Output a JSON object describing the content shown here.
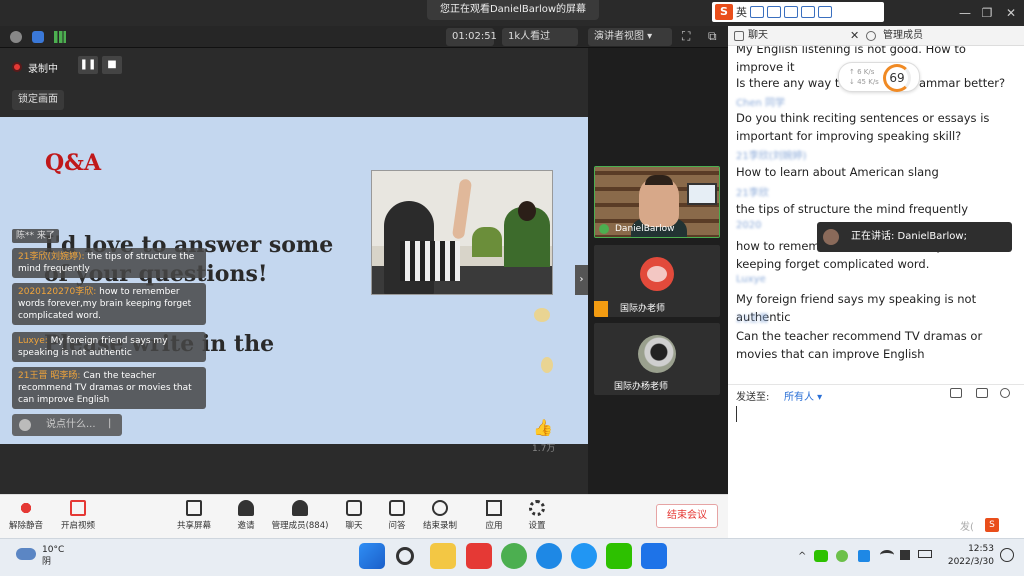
{
  "top": {
    "viewing_banner": "您正在观看DanielBarlow的屏幕",
    "ime_logo": "S",
    "ime_lang": "英",
    "win_min": "—",
    "win_max": "❐",
    "win_close": "✕"
  },
  "toolbar2": {
    "timer": "01:02:51",
    "viewers": "1k人看过",
    "view_mode": "演讲者视图 ▾",
    "fullscreen": "⛶",
    "popout": "⧉"
  },
  "recording": {
    "label": "录制中",
    "pause": "❚❚",
    "stop": "■",
    "lock": "锁定画面"
  },
  "slide": {
    "qa_title": "Q&A",
    "line1": "I'd love to answer some",
    "line2": "of your questions!",
    "line3": "Please write in the",
    "line4": "chat."
  },
  "danmu": {
    "tag": "陈** 来了",
    "items": [
      {
        "name": "21李欣(刘婉婷):",
        "text": "the tips of structure the mind frequently"
      },
      {
        "name": "2020120270李欣:",
        "text": "how to remember words forever,my brain keeping forget complicated word."
      },
      {
        "name": "Luxye:",
        "text": "My foreign friend says my speaking is not authentic"
      },
      {
        "name": "21王晋 昭李旸:",
        "text": "Can the teacher recommend TV dramas or movies that can improve English"
      }
    ],
    "say_placeholder": "说点什么...",
    "say_send": "|",
    "like_count": "1.7万"
  },
  "participants": [
    {
      "name": "DanielBarlow"
    },
    {
      "name": "国际办老师"
    },
    {
      "name": "国际办杨老师"
    }
  ],
  "chat": {
    "tab_chat": "聊天",
    "tab_members": "管理成员",
    "messages": [
      {
        "meta": "",
        "text": "My English listening is not good. How to improve it"
      },
      {
        "meta": "",
        "text": "Is there any way to make my grammar better?"
      },
      {
        "meta": "Chen 同学",
        "text": "Do you think reciting sentences or essays is important for improving speaking skill?"
      },
      {
        "meta": "21李欣(刘婉婷)",
        "text": "How to learn about American slang"
      },
      {
        "meta": "21李欣",
        "text": "the tips of structure the mind frequently"
      },
      {
        "meta": "2020",
        "text": "how to remember words forever,my brain keeping forget complicated word."
      },
      {
        "meta": "Luxye",
        "text": "My foreign friend says my speaking is not authentic"
      },
      {
        "meta": "21王晋",
        "text": "Can the teacher recommend TV dramas or movies that can improve English"
      }
    ],
    "speed_up": "↑ 6 K/s",
    "speed_down": "↓ 45 K/s",
    "speed_pct": "69",
    "speaking_label": "正在讲话: DanielBarlow;",
    "send_to_label": "发送至:",
    "send_to_value": "所有人 ▾",
    "send_footer": "发(",
    "ime_mini": "S"
  },
  "bottom": {
    "mute": "解除静音",
    "video": "开启视频",
    "share": "共享屏幕",
    "invite": "邀请",
    "members": "管理成员(884)",
    "chat": "聊天",
    "qa": "问答",
    "record": "结束录制",
    "apps": "应用",
    "settings": "设置",
    "end": "结束会议"
  },
  "taskbar": {
    "temp": "10°C",
    "weather": "阴",
    "time": "12:53",
    "date": "2022/3/30"
  },
  "colors": {
    "accent_red": "#e53935",
    "slide_bg": "#c4d7ef",
    "qa_red": "#c0181a",
    "danmu_name": "#f0a43a"
  }
}
